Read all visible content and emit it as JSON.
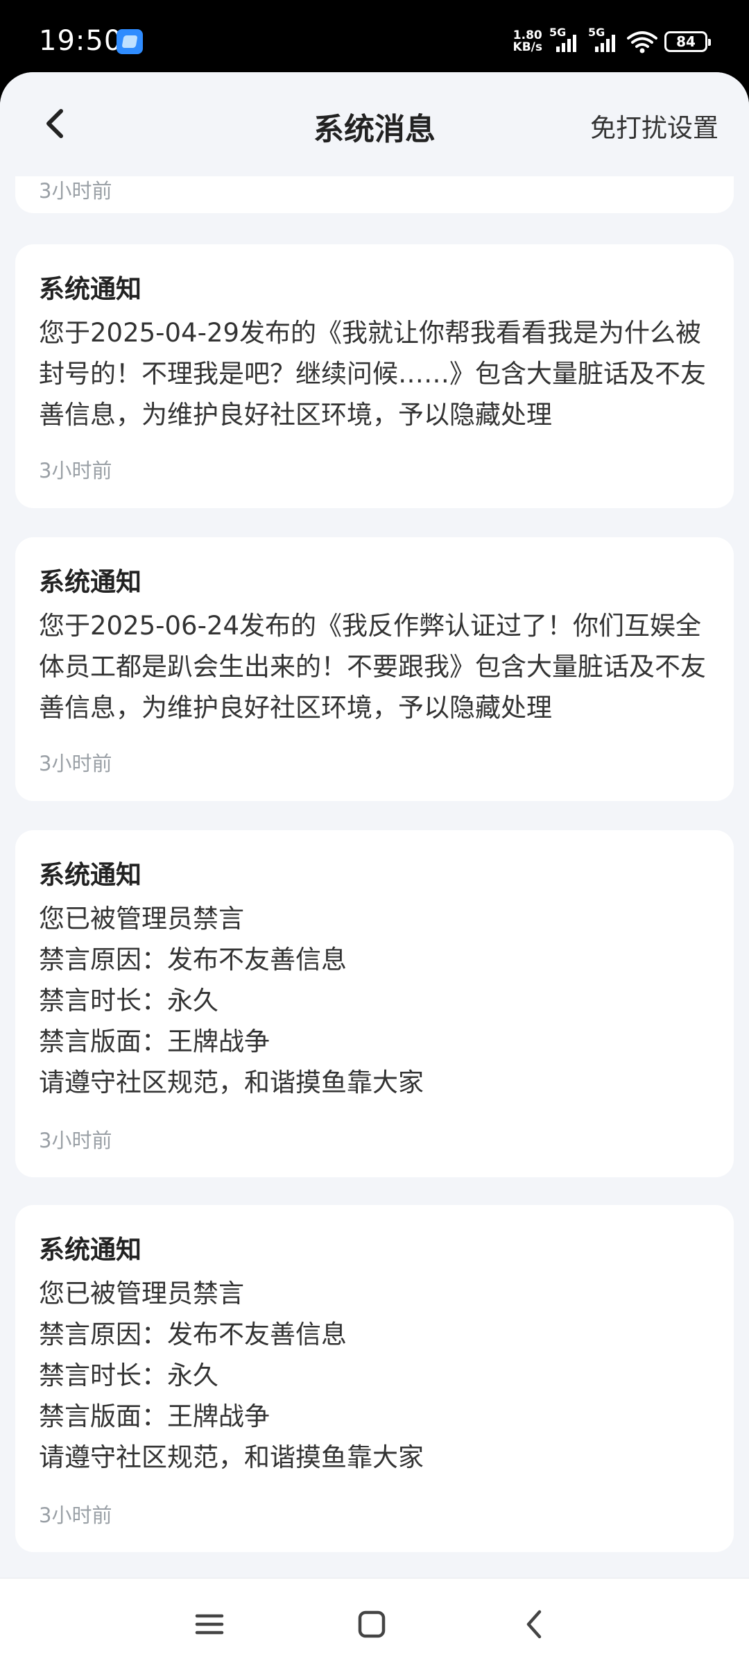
{
  "status": {
    "time": "19:50",
    "net_speed_value": "1.80",
    "net_speed_unit": "KB/s",
    "sim1_tag": "5G",
    "sim2_tag": "5G",
    "battery": "84"
  },
  "nav": {
    "title": "系统消息",
    "action": "免打扰设置"
  },
  "partial_card": {
    "time": "3小时前"
  },
  "cards": [
    {
      "title": "系统通知",
      "body": "您于2025-04-29发布的《我就让你帮我看看我是为什么被封号的！不理我是吧？继续问候……》包含大量脏话及不友善信息，为维护良好社区环境，予以隐藏处理",
      "time": "3小时前"
    },
    {
      "title": "系统通知",
      "body": "您于2025-06-24发布的《我反作弊认证过了！你们互娱全体员工都是趴会生出来的！不要跟我》包含大量脏话及不友善信息，为维护良好社区环境，予以隐藏处理",
      "time": "3小时前"
    },
    {
      "title": "系统通知",
      "body": "您已被管理员禁言\n禁言原因：发布不友善信息\n禁言时长：永久\n禁言版面：王牌战争\n请遵守社区规范，和谐摸鱼靠大家",
      "time": "3小时前"
    },
    {
      "title": "系统通知",
      "body": "您已被管理员禁言\n禁言原因：发布不友善信息\n禁言时长：永久\n禁言版面：王牌战争\n请遵守社区规范，和谐摸鱼靠大家",
      "time": "3小时前"
    }
  ],
  "icons": {
    "back": "chevron-left-icon",
    "menu": "menu-icon",
    "home": "home-icon",
    "sys_back": "back-icon"
  },
  "colors": {
    "page_bg": "#f3f5f9",
    "card_bg": "#ffffff",
    "time_text": "#9aa0a6"
  }
}
